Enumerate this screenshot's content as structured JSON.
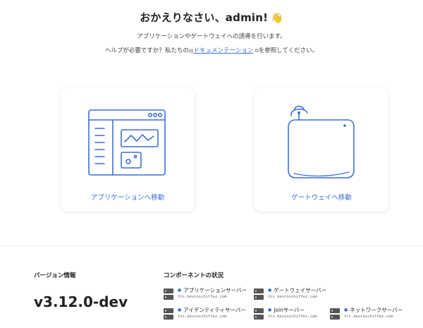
{
  "welcome": {
    "title": "おかえりなさい、admin!",
    "wave": "👋",
    "subtitle": "アプリケーションやゲートウェイへの誘導を行います。",
    "help_prefix": "ヘルプが必要ですか？私たちの",
    "doc_link": "ドキュメンテーション",
    "help_suffix": "を参照してください。"
  },
  "cards": {
    "applications": {
      "label": "アプリケーションへ移動",
      "icon": "application-window-icon"
    },
    "gateways": {
      "label": "ゲートウェイへ移動",
      "icon": "gateway-router-icon"
    }
  },
  "version": {
    "title": "バージョン情報",
    "value": "v3.12.0-dev"
  },
  "components": {
    "title": "コンポーネントの状況",
    "items": [
      {
        "name": "アプリケーションサーバー",
        "host": "tts.kevinschiffez.com"
      },
      {
        "name": "ゲートウェイサーバー",
        "host": "tts.kevinschiffez.com"
      },
      {
        "name": "アイデンティティサーバー",
        "host": "tts.kevinschiffez.com"
      },
      {
        "name": "Joinサーバー",
        "host": "tts.kevinschiffez.com"
      },
      {
        "name": "ネットワークサーバー",
        "host": "tts.kevinschiffez.com"
      }
    ]
  },
  "colors": {
    "accent": "#3b6fd6",
    "status_dot": "#3b6fd6"
  }
}
